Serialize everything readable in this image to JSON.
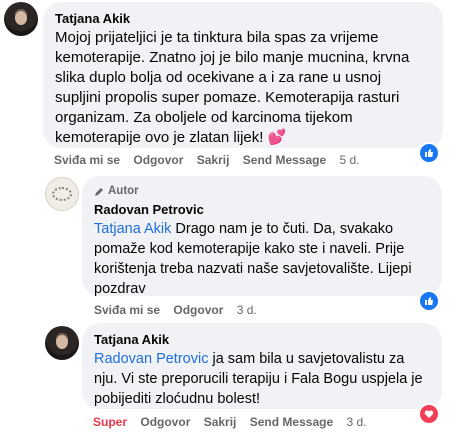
{
  "comment1": {
    "author": "Tatjana Akik",
    "text": "Mojoj prijateljici je ta tinktura bila spas za vrijeme kemoterapije. Znatno joj je bilo manje mucnina, krvna slika duplo bolja od ocekivane a i za rane u usnoj supljini propolis super pomaze. Kemoterapija rasturi organizam. Za oboljele od karcinoma tijekom kemoterapije ovo je zlatan lijek!",
    "emoji": "💕",
    "actions": {
      "like": "Sviđa mi se",
      "reply": "Odgovor",
      "hide": "Sakrij",
      "send": "Send Message",
      "time": "5 d."
    }
  },
  "comment2": {
    "author_tag": "Autor",
    "author": "Radovan Petrovic",
    "mention": "Tatjana Akik",
    "text": " Drago nam je to čuti. Da, svakako pomaže kod kemoterapije kako ste i naveli. Prije korištenja treba nazvati naše savjetovalište. Lijepi pozdrav",
    "actions": {
      "like": "Sviđa mi se",
      "reply": "Odgovor",
      "time": "3 d."
    }
  },
  "comment3": {
    "author": "Tatjana Akik",
    "mention": "Radovan Petrovic",
    "text": " ja sam bila u savjetovalistu za nju. Vi ste preporucili terapiju i Fala Bogu uspjela je pobijediti zloćudnu bolest!",
    "actions": {
      "reaction": "Super",
      "reply": "Odgovor",
      "hide": "Sakrij",
      "send": "Send Message",
      "time": "3 d."
    }
  },
  "colors": {
    "link": "#216fdb",
    "super": "#e8374b",
    "like_badge": "#1877f2",
    "bubble": "#f0f2f5"
  }
}
